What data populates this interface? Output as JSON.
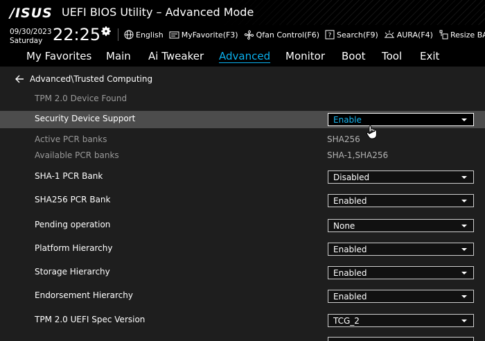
{
  "header": {
    "logo": "/ISUS",
    "title": "UEFI BIOS Utility – Advanced Mode",
    "date": "09/30/2023",
    "day": "Saturday",
    "time": "22:25"
  },
  "toolbar": {
    "items": [
      {
        "icon": "globe-icon",
        "label": "English"
      },
      {
        "icon": "myfavorite-icon",
        "label": "MyFavorite(F3)"
      },
      {
        "icon": "fan-icon",
        "label": "Qfan Control(F6)"
      },
      {
        "icon": "help-search-icon",
        "label": "Search(F9)"
      },
      {
        "icon": "aura-icon",
        "label": "AURA(F4)"
      },
      {
        "icon": "resize-bar-icon",
        "label": "Resize BAR"
      }
    ]
  },
  "tabs": [
    {
      "label": "My Favorites"
    },
    {
      "label": "Main"
    },
    {
      "label": "Ai Tweaker"
    },
    {
      "label": "Advanced",
      "active": true
    },
    {
      "label": "Monitor"
    },
    {
      "label": "Boot"
    },
    {
      "label": "Tool"
    },
    {
      "label": "Exit"
    }
  ],
  "breadcrumb": "Advanced\\Trusted Computing",
  "rows": {
    "tpm_found": "TPM 2.0 Device Found",
    "security_device": {
      "label": "Security Device Support",
      "value": "Enable"
    },
    "active_pcr": {
      "label": "Active PCR banks",
      "value": "SHA256"
    },
    "available_pcr": {
      "label": "Available PCR banks",
      "value": "SHA-1,SHA256"
    },
    "sha1_bank": {
      "label": "SHA-1 PCR Bank",
      "value": "Disabled"
    },
    "sha256_bank": {
      "label": "SHA256 PCR Bank",
      "value": "Enabled"
    },
    "pending_op": {
      "label": "Pending operation",
      "value": "None"
    },
    "platform_hier": {
      "label": "Platform Hierarchy",
      "value": "Enabled"
    },
    "storage_hier": {
      "label": "Storage Hierarchy",
      "value": "Enabled"
    },
    "endorse_hier": {
      "label": "Endorsement Hierarchy",
      "value": "Enabled"
    },
    "spec_version": {
      "label": "TPM 2.0 UEFI Spec Version",
      "value": "TCG_2"
    }
  },
  "colors": {
    "accent": "#0ab2f0",
    "highlight_row": "#4c4c4c",
    "background": "#1e1e1e"
  }
}
